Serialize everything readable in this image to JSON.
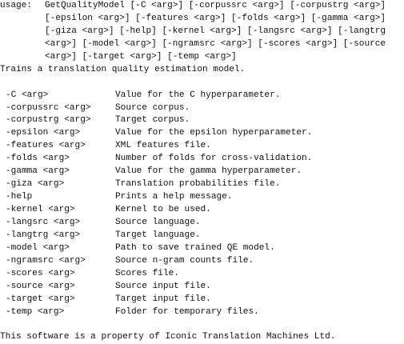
{
  "usage": {
    "prefix": "usage:",
    "lines": [
      "GetQualityModel [-C <arg>] [-corpussrc <arg>] [-corpustrg <arg>]",
      "[-epsilon <arg>] [-features <arg>] [-folds <arg>] [-gamma <arg>]",
      "[-giza <arg>] [-help] [-kernel <arg>] [-langsrc <arg>] [-langtrg",
      "<arg>] [-model <arg>] [-ngramsrc <arg>] [-scores <arg>] [-source",
      "<arg>] [-target <arg>] [-temp <arg>]"
    ]
  },
  "description": "Trains a translation quality estimation model.",
  "options": [
    {
      "name": "-C <arg>",
      "desc": "Value for the C hyperparameter."
    },
    {
      "name": "-corpussrc <arg>",
      "desc": "Source corpus."
    },
    {
      "name": "-corpustrg <arg>",
      "desc": "Target corpus."
    },
    {
      "name": "-epsilon <arg>",
      "desc": "Value for the epsilon hyperparameter."
    },
    {
      "name": "-features <arg>",
      "desc": "XML features file."
    },
    {
      "name": "-folds <arg>",
      "desc": "Number of folds for cross-validation."
    },
    {
      "name": "-gamma <arg>",
      "desc": "Value for the gamma hyperparameter."
    },
    {
      "name": "-giza <arg>",
      "desc": "Translation probabilities file."
    },
    {
      "name": "-help",
      "desc": "Prints a help message."
    },
    {
      "name": "-kernel <arg>",
      "desc": "Kernel to be used."
    },
    {
      "name": "-langsrc <arg>",
      "desc": "Source language."
    },
    {
      "name": "-langtrg <arg>",
      "desc": "Target language."
    },
    {
      "name": "-model <arg>",
      "desc": "Path to save trained QE model."
    },
    {
      "name": "-ngramsrc <arg>",
      "desc": "Source n-gram counts file."
    },
    {
      "name": "-scores <arg>",
      "desc": "Scores file."
    },
    {
      "name": "-source <arg>",
      "desc": "Source input file."
    },
    {
      "name": "-target <arg>",
      "desc": "Target input file."
    },
    {
      "name": "-temp <arg>",
      "desc": "Folder for temporary files."
    }
  ],
  "footer": "This software is a property of Iconic Translation Machines Ltd."
}
